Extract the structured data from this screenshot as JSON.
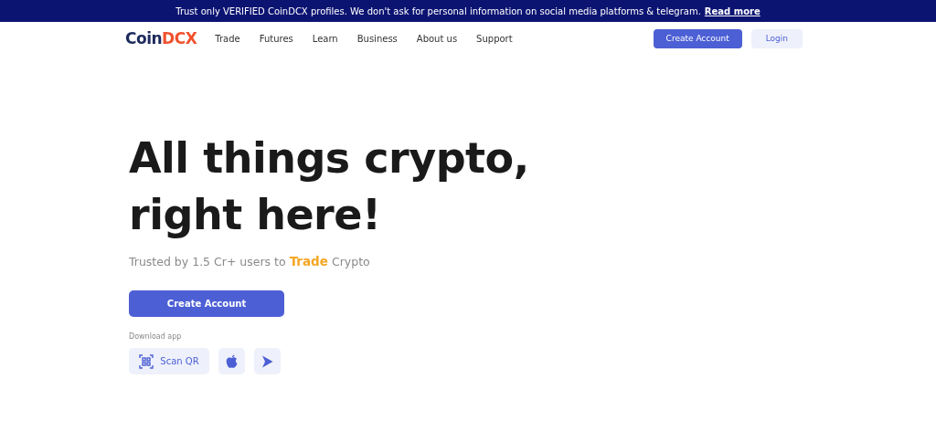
{
  "banner": {
    "text": "Trust only VERIFIED CoinDCX profiles. We don't ask for personal information on social media platforms & telegram.",
    "link": "Read more"
  },
  "logo": {
    "first": "Coin",
    "second": "DCX"
  },
  "nav": [
    "Trade",
    "Futures",
    "Learn",
    "Business",
    "About us",
    "Support"
  ],
  "header_buttons": {
    "primary": "Create Account",
    "secondary": "Login"
  },
  "hero": {
    "title_lines": [
      "All things crypto,",
      "right here!"
    ],
    "tagline": "Trusted by 1.5 Cr+ users to **Trade** Crypto",
    "cta": "Create Account",
    "download_label": "Download app",
    "scan": "Scan QR"
  }
}
